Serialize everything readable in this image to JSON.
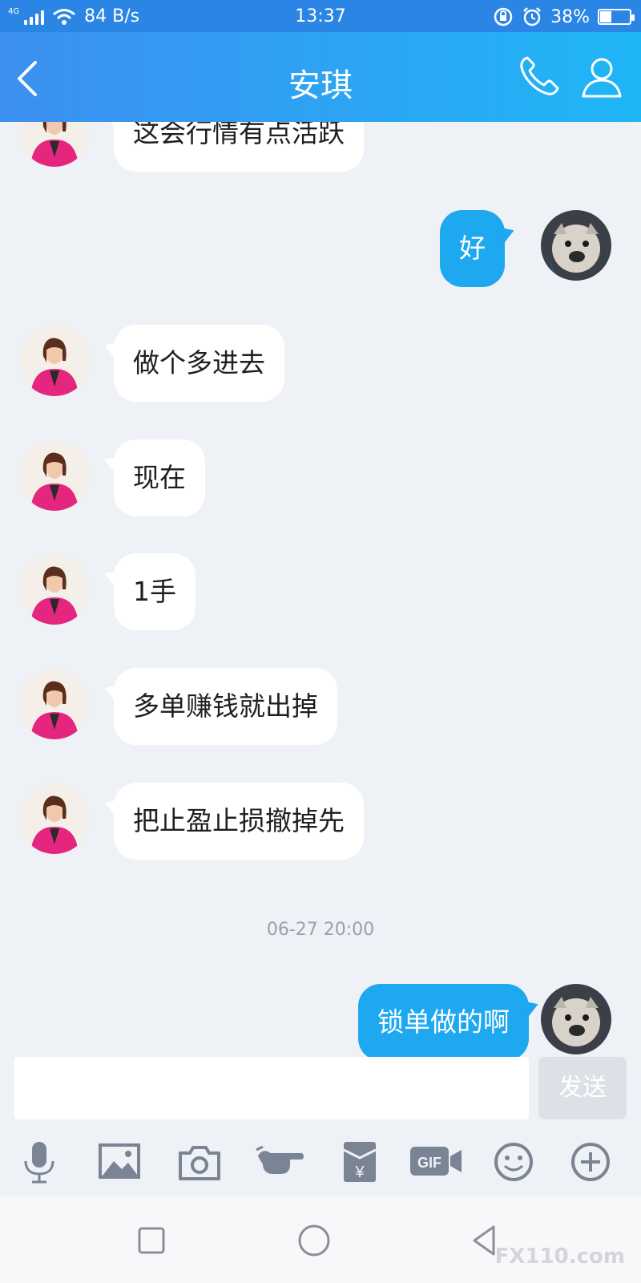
{
  "status_bar": {
    "network": "4G",
    "speed": "84 B/s",
    "time": "13:37",
    "battery": "38%",
    "battery_level": 0.38
  },
  "header": {
    "title": "安琪",
    "back_icon": "chevron-left-icon",
    "call_icon": "phone-icon",
    "profile_icon": "person-icon"
  },
  "messages": [
    {
      "side": "in",
      "text": "这会行情有点活跃"
    },
    {
      "side": "out",
      "text": "好"
    },
    {
      "side": "in",
      "text": "做个多进去"
    },
    {
      "side": "in",
      "text": "现在"
    },
    {
      "side": "in",
      "text": "1手"
    },
    {
      "side": "in",
      "text": "多单赚钱就出掉"
    },
    {
      "side": "in",
      "text": "把止盈止损撤掉先"
    },
    {
      "side": "out",
      "text": "锁单做的啊"
    }
  ],
  "timestamp": "06-27 20:00",
  "input": {
    "value": "",
    "send_label": "发送"
  },
  "toolbar": {
    "gif_label": "GIF",
    "items": [
      "microphone-icon",
      "image-icon",
      "camera-icon",
      "poke-icon",
      "red-packet-icon",
      "gif-icon",
      "emoji-icon",
      "plus-icon"
    ]
  },
  "nav": {
    "items": [
      "recent-apps-icon",
      "home-icon",
      "back-icon"
    ]
  },
  "watermark": "FX110.com",
  "colors": {
    "header_start": "#3c8ff0",
    "header_end": "#1fb6f6",
    "out_bubble": "#1da8f0",
    "background": "#eef1f6"
  }
}
